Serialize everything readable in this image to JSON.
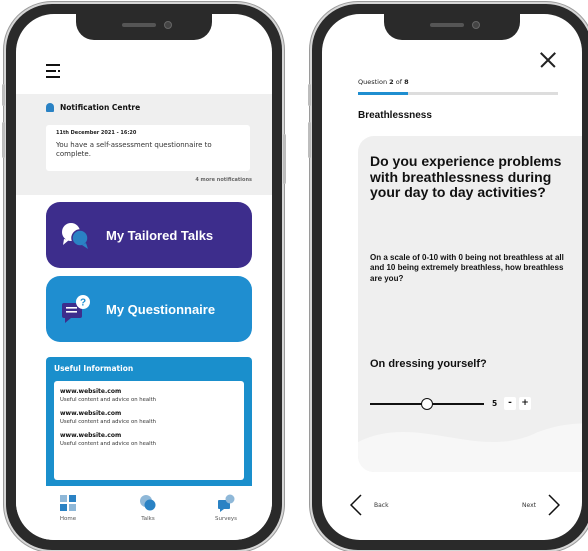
{
  "left_screen": {
    "notification_centre": {
      "title": "Notification Centre",
      "date": "11th December 2021 - 16:20",
      "message": "You have a self-assessment questionnaire to complete.",
      "more": "4 more notifications"
    },
    "buttons": {
      "talks": "My Tailored Talks",
      "questionnaire": "My Questionnaire"
    },
    "useful_information": {
      "title": "Useful Information",
      "items": [
        {
          "site": "www.website.com",
          "desc": "Useful content and advice on health"
        },
        {
          "site": "www.website.com",
          "desc": "Useful content and advice on health"
        },
        {
          "site": "www.website.com",
          "desc": "Useful content and advice on health"
        }
      ]
    },
    "tabbar": {
      "home": "Home",
      "talks": "Talks",
      "surveys": "Surveys"
    }
  },
  "right_screen": {
    "progress": {
      "prefix": "Question ",
      "current": "2",
      "of": " of ",
      "total": "8",
      "fraction": 0.25
    },
    "heading": "Breathlessness",
    "question": "Do you experience problems with breathlessness during your day to day activities?",
    "description": "On a scale of 0-10 with 0 being not breathless at all and 10 being extremely breathless, how breathless are you?",
    "sub_question": "On dressing yourself?",
    "slider": {
      "value": "5",
      "min": 0,
      "max": 10,
      "level": 5
    },
    "stepper": {
      "minus": "-",
      "plus": "+"
    },
    "nav": {
      "back": "Back",
      "next": "Next"
    }
  },
  "colors": {
    "talks_button": "#3d2d8c",
    "questionnaire_button": "#1f8ed0",
    "useful_panel": "#1a8fcc",
    "progress_fill": "#1f8ed0",
    "icons": [
      "menu-icon",
      "bell-icon",
      "chat-bubbles-icon",
      "question-chat-icon",
      "home-icon",
      "talks-icon",
      "surveys-icon",
      "close-icon",
      "chevron-left-icon",
      "chevron-right-icon"
    ]
  }
}
